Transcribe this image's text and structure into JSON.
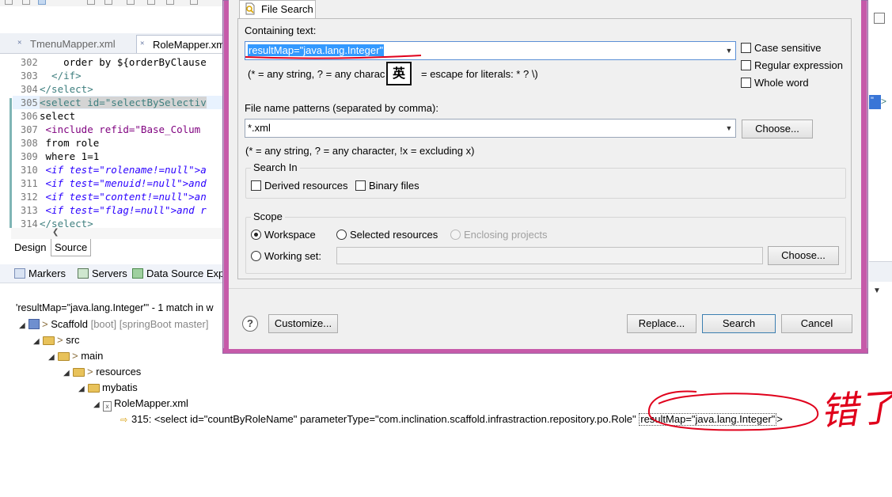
{
  "editor": {
    "tabs": [
      {
        "label": "TmenuMapper.xml"
      },
      {
        "label": "RoleMapper.xml"
      }
    ],
    "code_lines": [
      {
        "num": "302",
        "text": "    order by ${orderByClause"
      },
      {
        "num": "303",
        "text": "  </if>"
      },
      {
        "num": "304",
        "text": "</select>"
      },
      {
        "num": "305",
        "text": "<select id=\"selectBySelectiv"
      },
      {
        "num": "306",
        "text": "select"
      },
      {
        "num": "307",
        "text": " <include refid=\"Base_Colum"
      },
      {
        "num": "308",
        "text": " from role"
      },
      {
        "num": "309",
        "text": " where 1=1"
      },
      {
        "num": "310",
        "text": " <if test=\"rolename!=null\">a"
      },
      {
        "num": "311",
        "text": " <if test=\"menuid!=null\">and"
      },
      {
        "num": "312",
        "text": " <if test=\"content!=null\">an"
      },
      {
        "num": "313",
        "text": " <if test=\"flag!=null\">and r"
      },
      {
        "num": "314",
        "text": "</select>"
      }
    ],
    "bottom_tabs": {
      "design": "Design",
      "source": "Source"
    }
  },
  "views": {
    "tabs": [
      {
        "label": "Markers"
      },
      {
        "label": "Servers"
      },
      {
        "label": "Data Source Exp"
      }
    ]
  },
  "search_results": {
    "title": "'resultMap=\"java.lang.Integer\"' - 1 match in w",
    "project": {
      "name": "Scaffold",
      "decor": "[boot] [springBoot master]"
    },
    "folders": {
      "src": "src",
      "main": "main",
      "resources": "resources",
      "mybatis": "mybatis"
    },
    "file": "RoleMapper.xml",
    "match": {
      "prefix": "315: <select id=\"countByRoleName\" parameterType=\"com.inclination.scaffold.infrastraction.repository.po.Role\" ",
      "highlight": "resultMap=\"java.lang.Integer\"",
      "suffix": ">"
    }
  },
  "dialog": {
    "tab_label": "File Search",
    "containing_text_label": "Containing text:",
    "containing_text_value": "resultMap=\"java.lang.Integer\"",
    "containing_hint": "(* = any string, ? = any charac",
    "containing_hint_tail": "= escape for literals: * ? \\)",
    "ime_glyph": "英",
    "case_sensitive": "Case sensitive",
    "regular_expression": "Regular expression",
    "whole_word": "Whole word",
    "file_patterns_label": "File name patterns (separated by comma):",
    "file_patterns_value": "*.xml",
    "choose_label": "Choose...",
    "patterns_hint": "(* = any string, ? = any character, !x = excluding x)",
    "search_in": {
      "title": "Search In",
      "derived": "Derived resources",
      "binary": "Binary files"
    },
    "scope": {
      "title": "Scope",
      "workspace": "Workspace",
      "selected": "Selected resources",
      "enclosing": "Enclosing projects",
      "working_set": "Working set:",
      "working_set_value": "",
      "choose_label": "Choose..."
    },
    "buttons": {
      "customize": "Customize...",
      "replace": "Replace...",
      "search": "Search",
      "cancel": "Cancel"
    }
  },
  "annotations": {
    "handwritten": "错了"
  },
  "colors": {
    "selection": "#3399ff",
    "dialog_border": "#c65aa9",
    "annotation_red": "#e0001b"
  }
}
